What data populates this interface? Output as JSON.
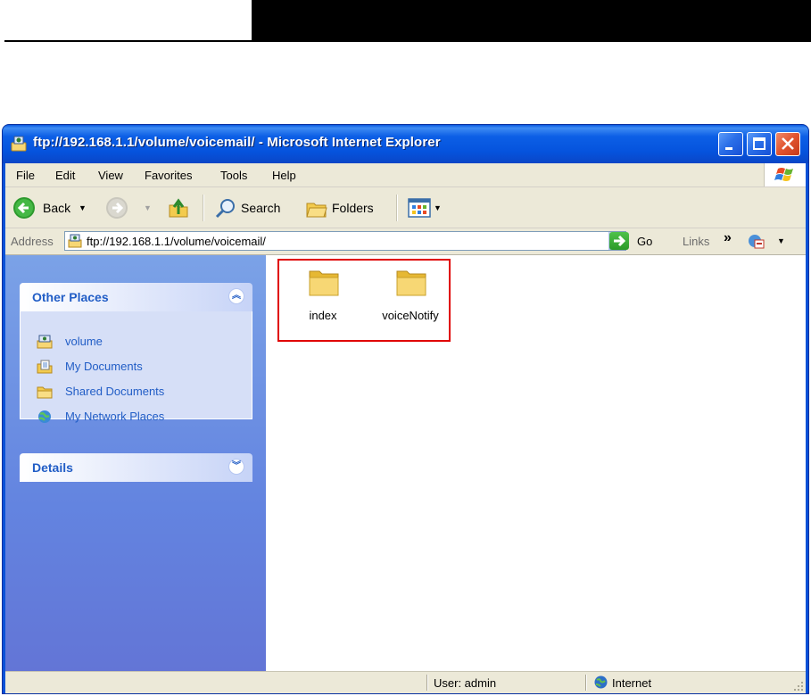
{
  "window": {
    "title": "ftp://192.168.1.1/volume/voicemail/ - Microsoft Internet Explorer"
  },
  "menu": {
    "items": [
      "File",
      "Edit",
      "View",
      "Favorites",
      "Tools",
      "Help"
    ]
  },
  "toolbar": {
    "back_label": "Back",
    "search_label": "Search",
    "folders_label": "Folders"
  },
  "address": {
    "label": "Address",
    "value": "ftp://192.168.1.1/volume/voicemail/",
    "go_label": "Go",
    "links_label": "Links"
  },
  "taskpane": {
    "other_places": {
      "title": "Other Places",
      "items": [
        {
          "label": "volume",
          "icon": "ftp-folder-icon"
        },
        {
          "label": "My Documents",
          "icon": "my-documents-icon"
        },
        {
          "label": "Shared Documents",
          "icon": "folder-icon"
        },
        {
          "label": "My Network Places",
          "icon": "network-places-icon"
        }
      ]
    },
    "details": {
      "title": "Details"
    }
  },
  "files": [
    {
      "name": "index",
      "icon": "folder-icon"
    },
    {
      "name": "voiceNotify",
      "icon": "folder-icon"
    }
  ],
  "status": {
    "user": "User: admin",
    "zone": "Internet"
  },
  "colors": {
    "titlebar": "#0553dd",
    "taskpane": "#6384e0",
    "panel_text": "#215dc6",
    "highlight_box": "#e00000"
  }
}
